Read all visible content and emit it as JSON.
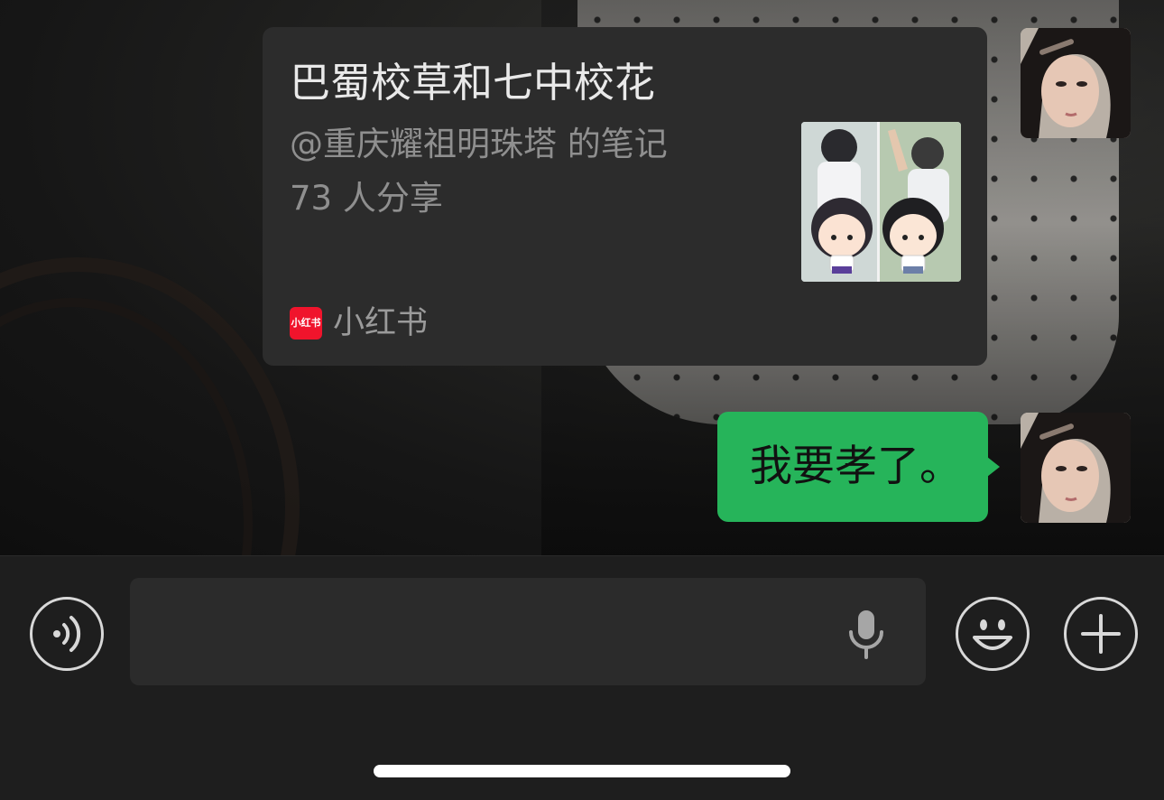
{
  "card": {
    "title": "巴蜀校草和七中校花",
    "author_line": "@重庆耀祖明珠塔 的笔记",
    "shares": "73 人分享",
    "source_name": "小红书",
    "source_logo_text": "小红书",
    "source_color": "#f0142c"
  },
  "message": {
    "text": "我要孝了。",
    "bubble_color": "#26b45a"
  },
  "input_bar": {
    "voice_toggle_icon": "voice-wave-icon",
    "mic_icon": "microphone-icon",
    "emoji_icon": "smile-emoji-icon",
    "more_icon": "plus-icon"
  }
}
